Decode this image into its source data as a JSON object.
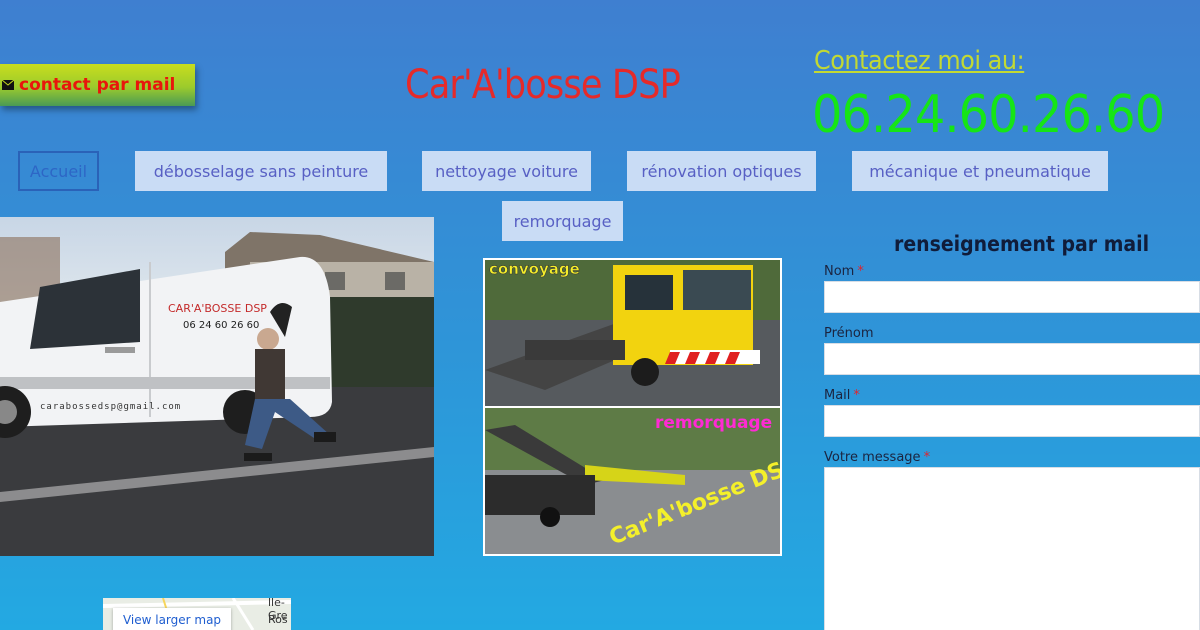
{
  "header": {
    "mail_button_label": "contact par mail",
    "site_title": "Car'A'bosse DSP",
    "contact_label": "Contactez moi au:",
    "phone": "06.24.60.26.60"
  },
  "nav": {
    "items": [
      {
        "label": "Accueil",
        "active": true
      },
      {
        "label": "débosselage sans peinture"
      },
      {
        "label": "nettoyage voiture"
      },
      {
        "label": "rénovation optiques"
      },
      {
        "label": "mécanique et pneumatique"
      },
      {
        "label": "remorquage"
      }
    ]
  },
  "photo_left": {
    "van_logo": "CAR'A'BOSSE DSP",
    "van_phone": "06 24 60 26 60",
    "van_email": "carabossedsp@gmail.com"
  },
  "photo_mid": {
    "top_caption": "convoyage",
    "bottom_caption": "remorquage",
    "watermark": "Car'A'bosse DSP"
  },
  "form": {
    "title": "renseignement par mail",
    "fields": [
      {
        "label": "Nom",
        "required": true
      },
      {
        "label": "Prénom",
        "required": false
      },
      {
        "label": "Mail",
        "required": true
      },
      {
        "label": "Votre message",
        "required": true
      }
    ],
    "required_marker": "*"
  },
  "map": {
    "button_label": "View larger map",
    "place_fragment": "Ros",
    "place_fragment_top": "lle-Gre"
  },
  "colors": {
    "title_red": "#e52a2a",
    "phone_green": "#16e516",
    "contact_yellow": "#c2d933",
    "nav_bg": "#c9dcf5",
    "nav_text": "#5860c4"
  }
}
